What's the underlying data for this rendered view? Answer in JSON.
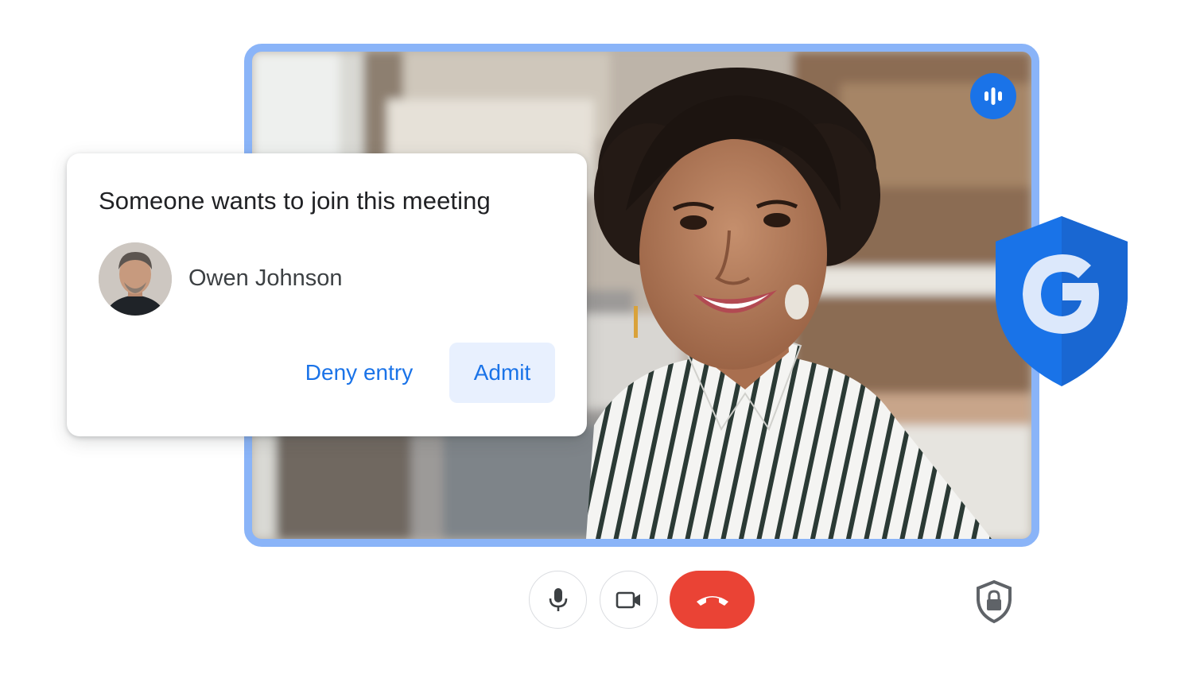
{
  "join_request": {
    "title": "Someone wants to join this meeting",
    "requester_name": "Owen Johnson",
    "deny_label": "Deny entry",
    "admit_label": "Admit"
  },
  "icons": {
    "speaking": "speaking-indicator-icon",
    "shield": "google-shield-icon",
    "mic": "microphone-icon",
    "camera": "videocam-icon",
    "hangup": "call-end-icon",
    "lock": "shield-lock-icon"
  },
  "colors": {
    "accent": "#1a73e8",
    "frame_border": "#8ab4f8",
    "hangup_red": "#ea4335",
    "admit_background": "#e8f0fe",
    "text_primary": "#202124",
    "text_secondary": "#3c4043"
  }
}
